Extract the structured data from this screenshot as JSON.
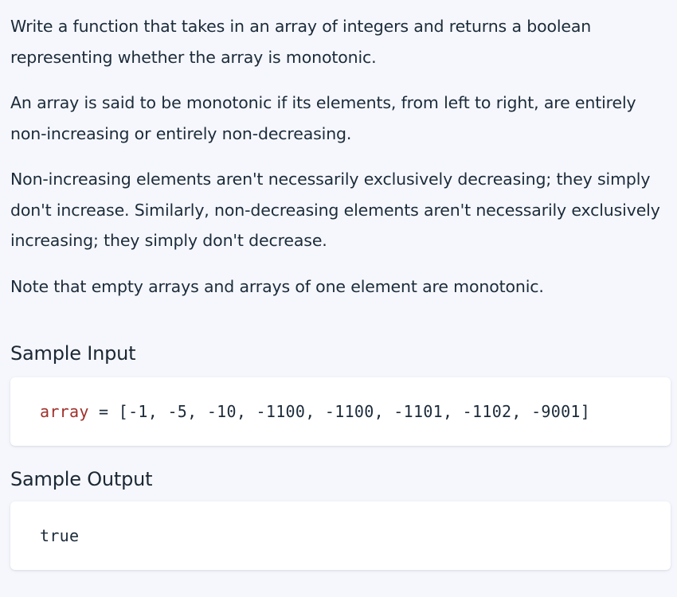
{
  "description": {
    "paragraphs": [
      "Write a function that takes in an array of integers and returns a boolean representing whether the array is monotonic.",
      "An array is said to be monotonic if its elements, from left to right, are entirely non-increasing or entirely non-decreasing.",
      "Non-increasing elements aren't necessarily exclusively decreasing; they simply don't increase. Similarly, non-decreasing elements aren't necessarily exclusively increasing; they simply don't decrease.",
      "Note that empty arrays and arrays of one element are monotonic."
    ]
  },
  "sample_input": {
    "heading": "Sample Input",
    "variable": "array",
    "operator": " = ",
    "value": "[-1, -5, -10, -1100, -1100, -1101, -1102, -9001]"
  },
  "sample_output": {
    "heading": "Sample Output",
    "value": "true"
  },
  "colors": {
    "background": "#f5f7fc",
    "text": "#1c2b3a",
    "code_variable": "#a0302a",
    "code_box": "#ffffff"
  }
}
